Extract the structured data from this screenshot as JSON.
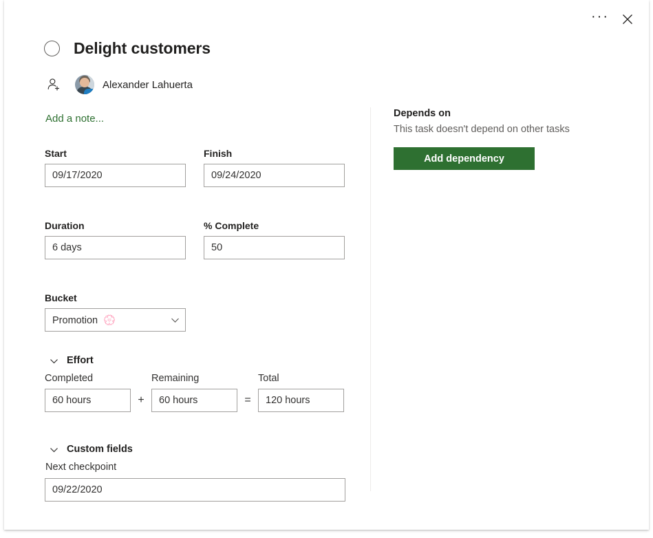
{
  "window": {
    "more_options_label": "···",
    "close_label": "✕"
  },
  "task": {
    "title": "Delight customers",
    "completed": false,
    "assignee": {
      "name": "Alexander Lahuerta",
      "avatar_alt": "Alexander Lahuerta"
    },
    "note_placeholder": "Add a note..."
  },
  "fields": {
    "start": {
      "label": "Start",
      "value": "09/17/2020"
    },
    "finish": {
      "label": "Finish",
      "value": "09/24/2020"
    },
    "duration": {
      "label": "Duration",
      "value": "6 days"
    },
    "percent_complete": {
      "label": "% Complete",
      "value": "50"
    },
    "bucket": {
      "label": "Bucket",
      "value": "Promotion",
      "emoji": "💮",
      "options": [
        "Promotion 💮"
      ]
    }
  },
  "effort": {
    "section_title": "Effort",
    "expanded": true,
    "completed": {
      "label": "Completed",
      "value": "60 hours"
    },
    "operator_plus": "+",
    "remaining": {
      "label": "Remaining",
      "value": "60 hours"
    },
    "operator_equals": "=",
    "total": {
      "label": "Total",
      "value": "120 hours"
    }
  },
  "custom_fields": {
    "section_title": "Custom fields",
    "expanded": true,
    "items": [
      {
        "label": "Next checkpoint",
        "value": "09/22/2020"
      }
    ]
  },
  "depends_on": {
    "title": "Depends on",
    "empty_message": "This task doesn't depend on other tasks",
    "add_button_label": "Add dependency"
  },
  "colors": {
    "accent_green": "#2e7031",
    "text_primary": "#201f1e",
    "text_secondary": "#605e5c",
    "border": "#a19f9d",
    "divider": "#edebe9"
  }
}
